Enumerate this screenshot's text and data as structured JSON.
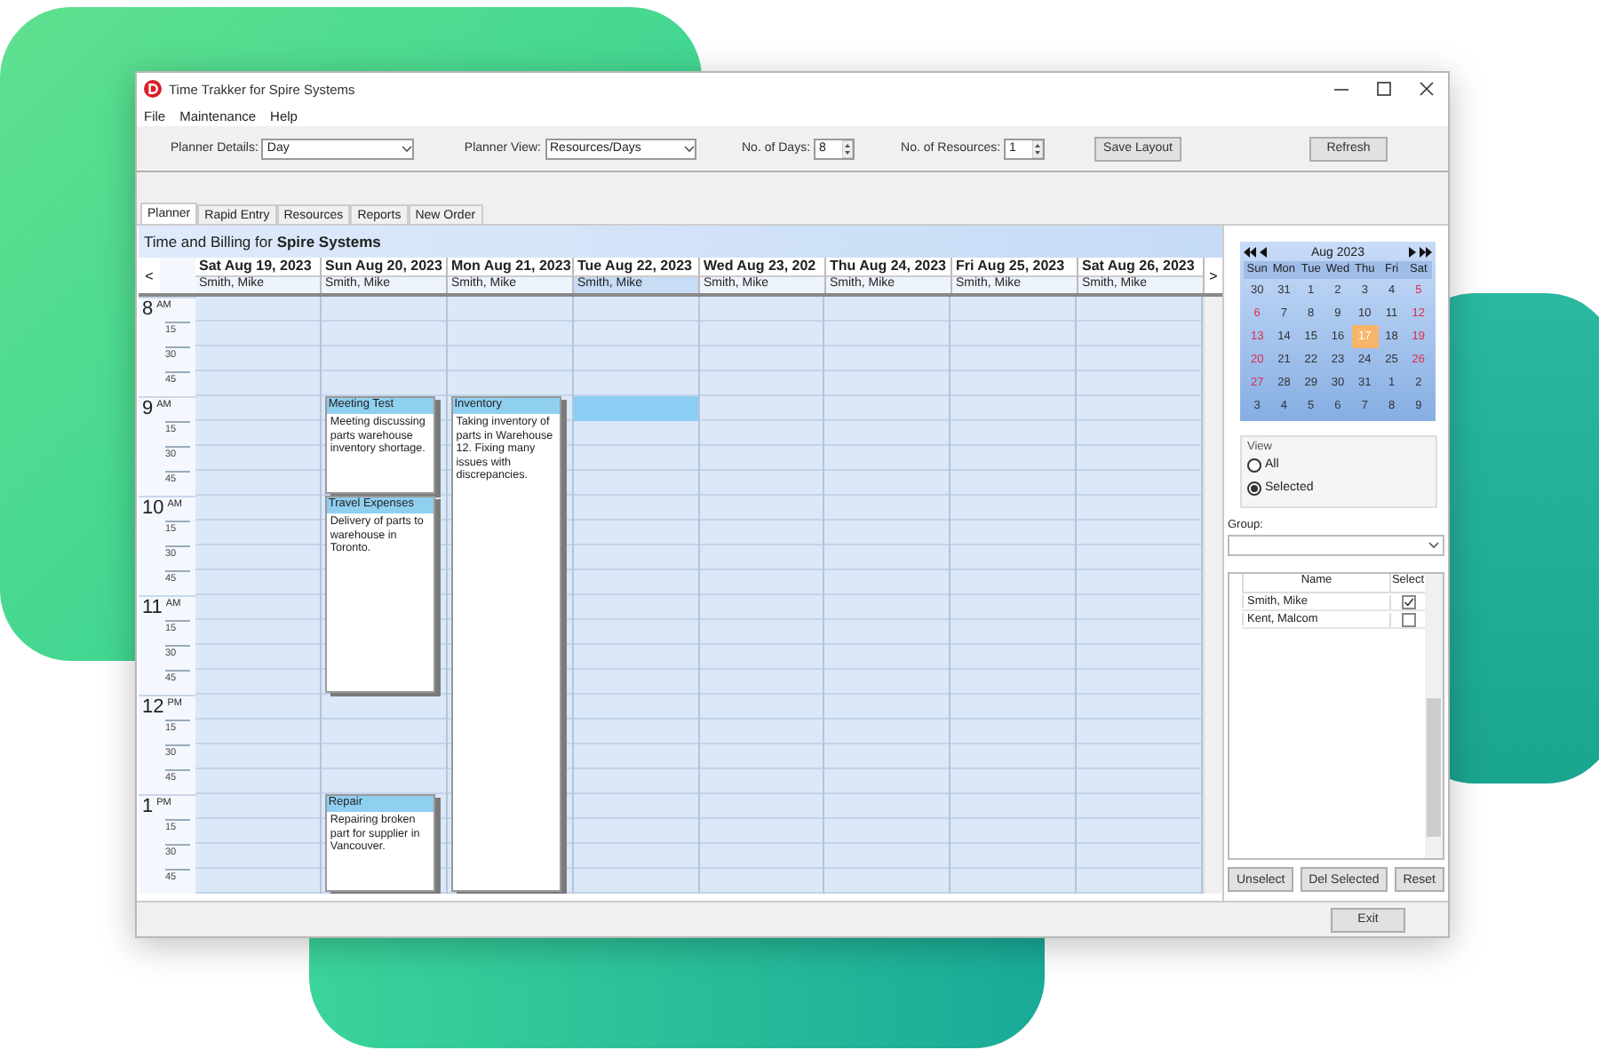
{
  "window": {
    "title": "Time Trakker for Spire Systems"
  },
  "menu": [
    "File",
    "Maintenance",
    "Help"
  ],
  "toolbar": {
    "planner_details": {
      "label": "Planner Details:",
      "value": "Day"
    },
    "planner_view": {
      "label": "Planner View:",
      "value": "Resources/Days"
    },
    "days": {
      "label": "No. of Days:",
      "value": "8"
    },
    "resources": {
      "label": "No. of Resources:",
      "value": "1"
    },
    "buttons": [
      "Save Layout",
      "Refresh"
    ]
  },
  "tabs": [
    {
      "label": "Planner",
      "selected": true
    },
    {
      "label": "Rapid Entry",
      "selected": false
    },
    {
      "label": "Resources",
      "selected": false
    },
    {
      "label": "Reports",
      "selected": false
    },
    {
      "label": "New Order",
      "selected": false
    }
  ],
  "planner": {
    "title": "Time and Billing for **Spire Systems**",
    "prev": "<",
    "next": ">",
    "hours": [
      {
        "hour": "8",
        "period": "AM",
        "marks": [
          "15",
          "30",
          "45"
        ]
      },
      {
        "hour": "9",
        "period": "AM",
        "marks": [
          "15",
          "30",
          "45"
        ]
      },
      {
        "hour": "10",
        "period": "AM",
        "marks": [
          "15",
          "30",
          "45"
        ]
      },
      {
        "hour": "11",
        "period": "AM",
        "marks": [
          "15",
          "30",
          "45"
        ]
      },
      {
        "hour": "12",
        "period": "PM",
        "marks": [
          "15",
          "30",
          "45"
        ]
      },
      {
        "hour": "1",
        "period": "PM",
        "marks": [
          "15",
          "30",
          "45"
        ]
      }
    ],
    "days": [
      {
        "date": "Sat Aug 19, 2023",
        "resource": "Smith, Mike",
        "selected": false
      },
      {
        "date": "Sun Aug 20, 2023",
        "resource": "Smith, Mike",
        "selected": false,
        "events": [
          {
            "title": "Meeting Test",
            "text": "Meeting discussing parts warehouse inventory shortage."
          },
          {
            "title": "Travel Expenses",
            "text": "Delivery of parts to warehouse in Toronto."
          },
          {
            "title": "Repair",
            "text": "Repairing broken part for supplier in Vancouver."
          }
        ]
      },
      {
        "date": "Mon Aug 21, 2023",
        "resource": "Smith, Mike",
        "selected": false,
        "events": [
          {
            "title": "Inventory",
            "text": "Taking inventory of parts in Warehouse 12. Fixing many issues with discrepancies."
          }
        ]
      },
      {
        "date": "Tue Aug 22, 2023",
        "resource": "Smith, Mike",
        "selected": true
      },
      {
        "date": "Wed Aug 23, 202",
        "resource": "Smith, Mike",
        "selected": false
      },
      {
        "date": "Thu Aug 24, 2023",
        "resource": "Smith, Mike",
        "selected": false
      },
      {
        "date": "Fri Aug 25, 2023",
        "resource": "Smith, Mike",
        "selected": false
      },
      {
        "date": "Sat Aug 26, 2023",
        "resource": "Smith, Mike",
        "selected": false
      }
    ]
  },
  "mini_calendar": {
    "month": "Aug 2023",
    "weekdays": [
      "Sun",
      "Mon",
      "Tue",
      "Wed",
      "Thu",
      "Fri",
      "Sat"
    ],
    "days": [
      {
        "d": "30",
        "weekend": false,
        "selected": false
      },
      {
        "d": "31",
        "weekend": false,
        "selected": false
      },
      {
        "d": "1",
        "weekend": false,
        "selected": false
      },
      {
        "d": "2",
        "weekend": false,
        "selected": false
      },
      {
        "d": "3",
        "weekend": false,
        "selected": false
      },
      {
        "d": "4",
        "weekend": false,
        "selected": false
      },
      {
        "d": "5",
        "weekend": true,
        "selected": false
      },
      {
        "d": "6",
        "weekend": true,
        "selected": false
      },
      {
        "d": "7",
        "weekend": false,
        "selected": false
      },
      {
        "d": "8",
        "weekend": false,
        "selected": false
      },
      {
        "d": "9",
        "weekend": false,
        "selected": false
      },
      {
        "d": "10",
        "weekend": false,
        "selected": false
      },
      {
        "d": "11",
        "weekend": false,
        "selected": false
      },
      {
        "d": "12",
        "weekend": true,
        "selected": false
      },
      {
        "d": "13",
        "weekend": true,
        "selected": false
      },
      {
        "d": "14",
        "weekend": false,
        "selected": false
      },
      {
        "d": "15",
        "weekend": false,
        "selected": false
      },
      {
        "d": "16",
        "weekend": false,
        "selected": false
      },
      {
        "d": "17",
        "weekend": false,
        "selected": true
      },
      {
        "d": "18",
        "weekend": false,
        "selected": false
      },
      {
        "d": "19",
        "weekend": true,
        "selected": false
      },
      {
        "d": "20",
        "weekend": true,
        "selected": false
      },
      {
        "d": "21",
        "weekend": false,
        "selected": false
      },
      {
        "d": "22",
        "weekend": false,
        "selected": false
      },
      {
        "d": "23",
        "weekend": false,
        "selected": false
      },
      {
        "d": "24",
        "weekend": false,
        "selected": false
      },
      {
        "d": "25",
        "weekend": false,
        "selected": false
      },
      {
        "d": "26",
        "weekend": true,
        "selected": false
      },
      {
        "d": "27",
        "weekend": true,
        "selected": false
      },
      {
        "d": "28",
        "weekend": false,
        "selected": false
      },
      {
        "d": "29",
        "weekend": false,
        "selected": false
      },
      {
        "d": "30",
        "weekend": false,
        "selected": false
      },
      {
        "d": "31",
        "weekend": false,
        "selected": false
      },
      {
        "d": "1",
        "weekend": false,
        "selected": false
      },
      {
        "d": "2",
        "weekend": false,
        "selected": false
      },
      {
        "d": "3",
        "weekend": false,
        "selected": false
      },
      {
        "d": "4",
        "weekend": false,
        "selected": false
      },
      {
        "d": "5",
        "weekend": false,
        "selected": false
      },
      {
        "d": "6",
        "weekend": false,
        "selected": false
      },
      {
        "d": "7",
        "weekend": false,
        "selected": false
      },
      {
        "d": "8",
        "weekend": false,
        "selected": false
      },
      {
        "d": "9",
        "weekend": false,
        "selected": false
      }
    ]
  },
  "view": {
    "label": "View",
    "options": [
      {
        "label": "All",
        "selected": false
      },
      {
        "label": "Selected",
        "selected": true
      }
    ]
  },
  "group": {
    "label": "Group:"
  },
  "resource_table": {
    "columns": [
      "Name",
      "Select"
    ],
    "rows": [
      {
        "name": "Smith, Mike",
        "checked": true
      },
      {
        "name": "Kent, Malcom",
        "checked": false
      }
    ]
  },
  "panel_buttons": [
    "Unselect",
    "Del Selected",
    "Reset"
  ],
  "footer_buttons": [
    "Exit"
  ]
}
